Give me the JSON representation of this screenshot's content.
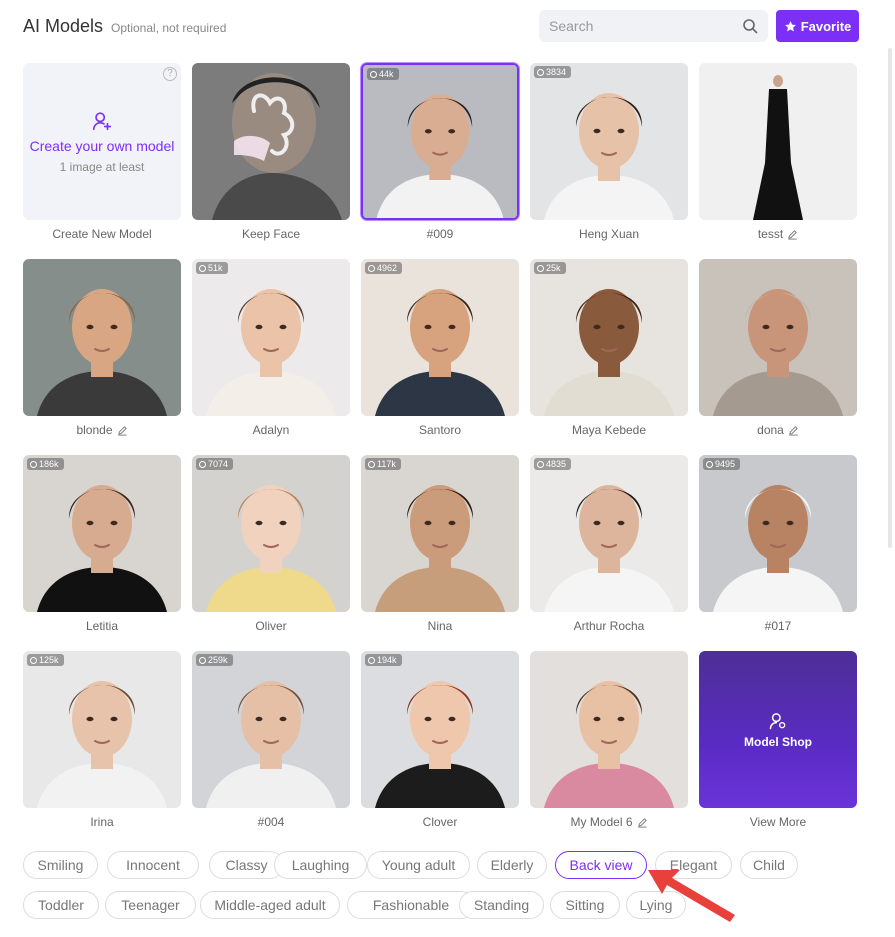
{
  "header": {
    "title": "AI Models",
    "subtitle": "Optional, not required",
    "search_placeholder": "Search",
    "favorite_label": "Favorite"
  },
  "create_card": {
    "label": "Create your own model",
    "sublabel": "1 image at least",
    "caption": "Create New Model",
    "help": "?"
  },
  "models": [
    {
      "name": "Keep Face",
      "count": "",
      "editable": false
    },
    {
      "name": "#009",
      "count": "44k",
      "editable": false,
      "selected": true
    },
    {
      "name": "Heng Xuan",
      "count": "3834",
      "editable": false
    },
    {
      "name": "tesst",
      "count": "",
      "editable": true
    },
    {
      "name": "blonde",
      "count": "",
      "editable": true
    },
    {
      "name": "Adalyn",
      "count": "51k",
      "editable": false
    },
    {
      "name": "Santoro",
      "count": "4962",
      "editable": false
    },
    {
      "name": "Maya Kebede",
      "count": "25k",
      "editable": false
    },
    {
      "name": "dona",
      "count": "",
      "editable": true
    },
    {
      "name": "Letitia",
      "count": "186k",
      "editable": false
    },
    {
      "name": "Oliver",
      "count": "7074",
      "editable": false
    },
    {
      "name": "Nina",
      "count": "117k",
      "editable": false
    },
    {
      "name": "Arthur Rocha",
      "count": "4835",
      "editable": false
    },
    {
      "name": "#017",
      "count": "9495",
      "editable": false
    },
    {
      "name": "Irina",
      "count": "125k",
      "editable": false
    },
    {
      "name": "#004",
      "count": "259k",
      "editable": false
    },
    {
      "name": "Clover",
      "count": "194k",
      "editable": false
    },
    {
      "name": "My Model 6",
      "count": "",
      "editable": true
    }
  ],
  "shop_card": {
    "label": "Model Shop",
    "caption": "View More"
  },
  "tags": [
    "Smiling",
    "Innocent",
    "Classy",
    "Laughing",
    "Young adult",
    "Elderly",
    "Back view",
    "Elegant",
    "Child",
    "Toddler",
    "Teenager",
    "Middle-aged adult",
    "Fashionable",
    "Standing",
    "Sitting",
    "Lying"
  ],
  "active_tag": "Back view",
  "colors": {
    "accent": "#7b2ff7",
    "annotation_arrow": "#e8403a"
  }
}
